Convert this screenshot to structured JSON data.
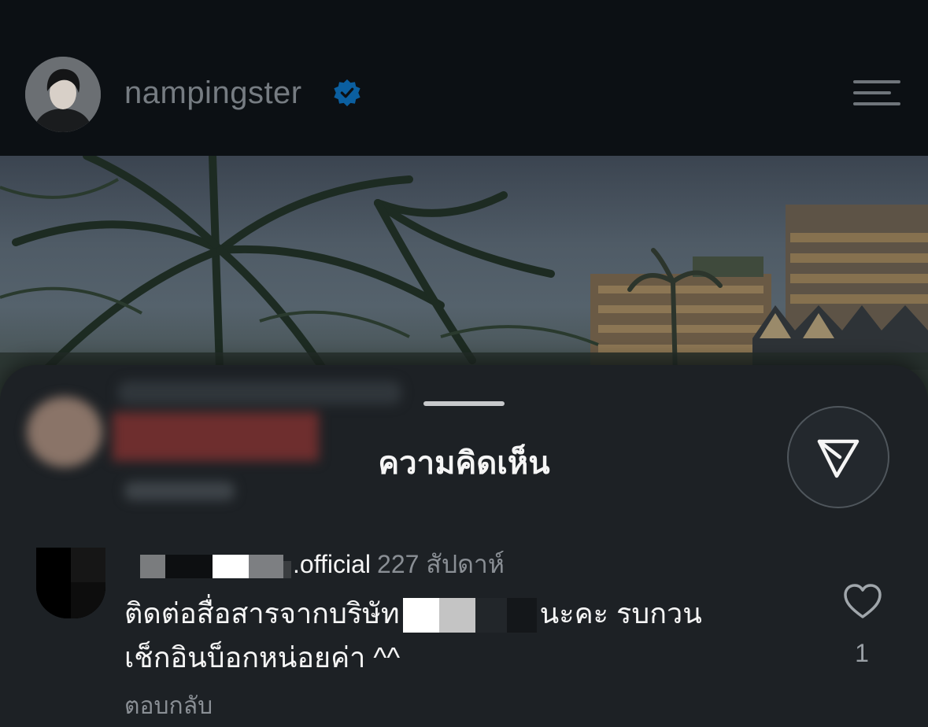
{
  "profile": {
    "username": "nampingster",
    "verified": true
  },
  "icons": {
    "verified": "verified-badge-icon",
    "menu": "menu-icon",
    "share": "send-icon",
    "like": "heart-icon"
  },
  "comments_sheet": {
    "title": "ความคิดเห็น",
    "comment": {
      "username_suffix": ".official",
      "time": "227 สัปดาห์",
      "text_part1": "ติดต่อสื่อสารจากบริษัท",
      "text_part2": "นะคะ รบกวน",
      "text_line2": "เช็กอินบ็อกหน่อยค่า ^^",
      "reply_label": "ตอบกลับ",
      "like_count": "1"
    }
  },
  "colors": {
    "background": "#0c1014",
    "sheet": "#1d2125",
    "verified_blue": "#0095f6",
    "muted_text": "#8a8f95"
  }
}
